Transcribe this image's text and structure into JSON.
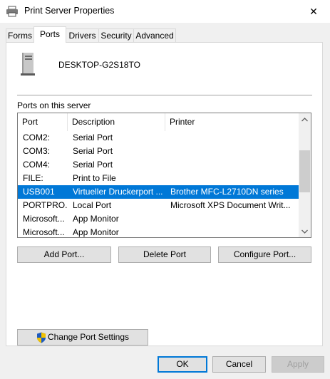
{
  "window": {
    "title": "Print Server Properties",
    "close_glyph": "✕"
  },
  "tabs": [
    {
      "label": "Forms"
    },
    {
      "label": "Ports",
      "active": true
    },
    {
      "label": "Drivers"
    },
    {
      "label": "Security"
    },
    {
      "label": "Advanced"
    }
  ],
  "server": {
    "name": "DESKTOP-G2S18TO"
  },
  "ports": {
    "section_label": "Ports on this server",
    "columns": [
      "Port",
      "Description",
      "Printer"
    ],
    "rows": [
      {
        "port": "COM2:",
        "description": "Serial Port",
        "printer": ""
      },
      {
        "port": "COM3:",
        "description": "Serial Port",
        "printer": ""
      },
      {
        "port": "COM4:",
        "description": "Serial Port",
        "printer": ""
      },
      {
        "port": "FILE:",
        "description": "Print to File",
        "printer": ""
      },
      {
        "port": "USB001",
        "description": "Virtueller Druckerport ...",
        "printer": "Brother MFC-L2710DN series",
        "selected": true
      },
      {
        "port": "PORTPRO...",
        "description": "Local Port",
        "printer": "Microsoft XPS Document Writ..."
      },
      {
        "port": "Microsoft...",
        "description": "App Monitor",
        "printer": ""
      },
      {
        "port": "Microsoft...",
        "description": "App Monitor",
        "printer": ""
      }
    ]
  },
  "buttons": {
    "add_port": "Add Port...",
    "delete_port": "Delete Port",
    "configure_port": "Configure Port...",
    "change_port_settings": "Change Port Settings"
  },
  "footer": {
    "ok": "OK",
    "cancel": "Cancel",
    "apply": "Apply"
  },
  "colors": {
    "selection": "#0078d7",
    "shield_blue": "#1e5bbf",
    "shield_yellow": "#f2c200"
  }
}
